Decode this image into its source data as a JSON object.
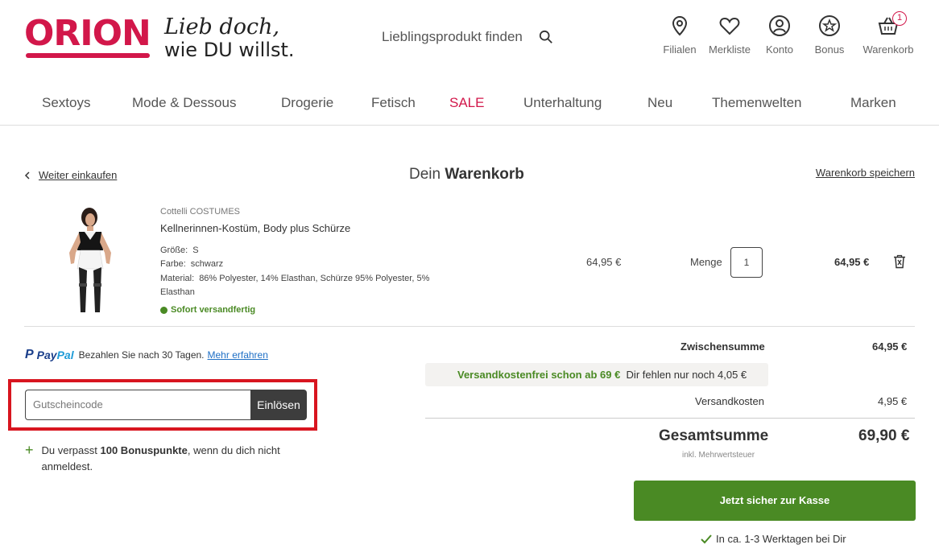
{
  "header": {
    "logo": "ORION",
    "slogan_line1": "Lieb doch,",
    "slogan_line2": "wie DU willst.",
    "search_placeholder": "Lieblingsprodukt finden",
    "icons": [
      {
        "label": "Filialen",
        "icon": "location-pin-icon"
      },
      {
        "label": "Merkliste",
        "icon": "heart-icon"
      },
      {
        "label": "Konto",
        "icon": "user-icon"
      },
      {
        "label": "Bonus",
        "icon": "star-icon"
      },
      {
        "label": "Warenkorb",
        "icon": "basket-icon"
      }
    ],
    "cart_count": "1"
  },
  "nav": {
    "items": [
      "Sextoys",
      "Mode & Dessous",
      "Drogerie",
      "Fetisch",
      "SALE",
      "Unterhaltung",
      "Neu",
      "Themenwelten",
      "Marken"
    ]
  },
  "cart": {
    "back_label": "Weiter einkaufen",
    "title_prefix": "Dein",
    "title_bold": "Warenkorb",
    "save_label": "Warenkorb speichern"
  },
  "product": {
    "brand": "Cottelli COSTUMES",
    "name": "Kellnerinnen-Kostüm, Body plus Schürze",
    "size_label": "Größe:",
    "size_value": "S",
    "color_label": "Farbe:",
    "color_value": "schwarz",
    "material_label": "Material:",
    "material_value1": "86% Polyester, 14% Elasthan, Schürze 95% Polyester, 5%",
    "material_value2": "Elasthan",
    "availability": "Sofort versandfertig",
    "unit_price": "64,95 €",
    "qty_label": "Menge",
    "qty_value": "1",
    "line_total": "64,95 €"
  },
  "paypal": {
    "logo_a": "Pay",
    "logo_b": "Pal",
    "text": "Bezahlen Sie nach 30 Tagen.",
    "link": "Mehr erfahren"
  },
  "coupon": {
    "placeholder": "Gutscheincode",
    "button": "Einlösen"
  },
  "bonus": {
    "text_before": "Du verpasst ",
    "points": "100 Bonuspunkte",
    "text_after": ", wenn du dich nicht anmeldest."
  },
  "summary": {
    "subtotal_label": "Zwischensumme",
    "subtotal_value": "64,95 €",
    "free_shipping_bold": "Versandkostenfrei schon ab 69 €",
    "free_shipping_text": "Dir fehlen nur noch 4,05 €",
    "shipping_label": "Versandkosten",
    "shipping_value": "4,95 €",
    "total_label": "Gesamtsumme",
    "total_value": "69,90 €",
    "vat_note": "inkl. Mehrwertsteuer",
    "checkout_button": "Jetzt sicher zur Kasse",
    "delivery_note": "In ca. 1-3 Werktagen bei Dir"
  },
  "colors": {
    "brand": "#d2174a",
    "accent_green": "#4a8a24",
    "highlight_frame": "#d8151f"
  }
}
